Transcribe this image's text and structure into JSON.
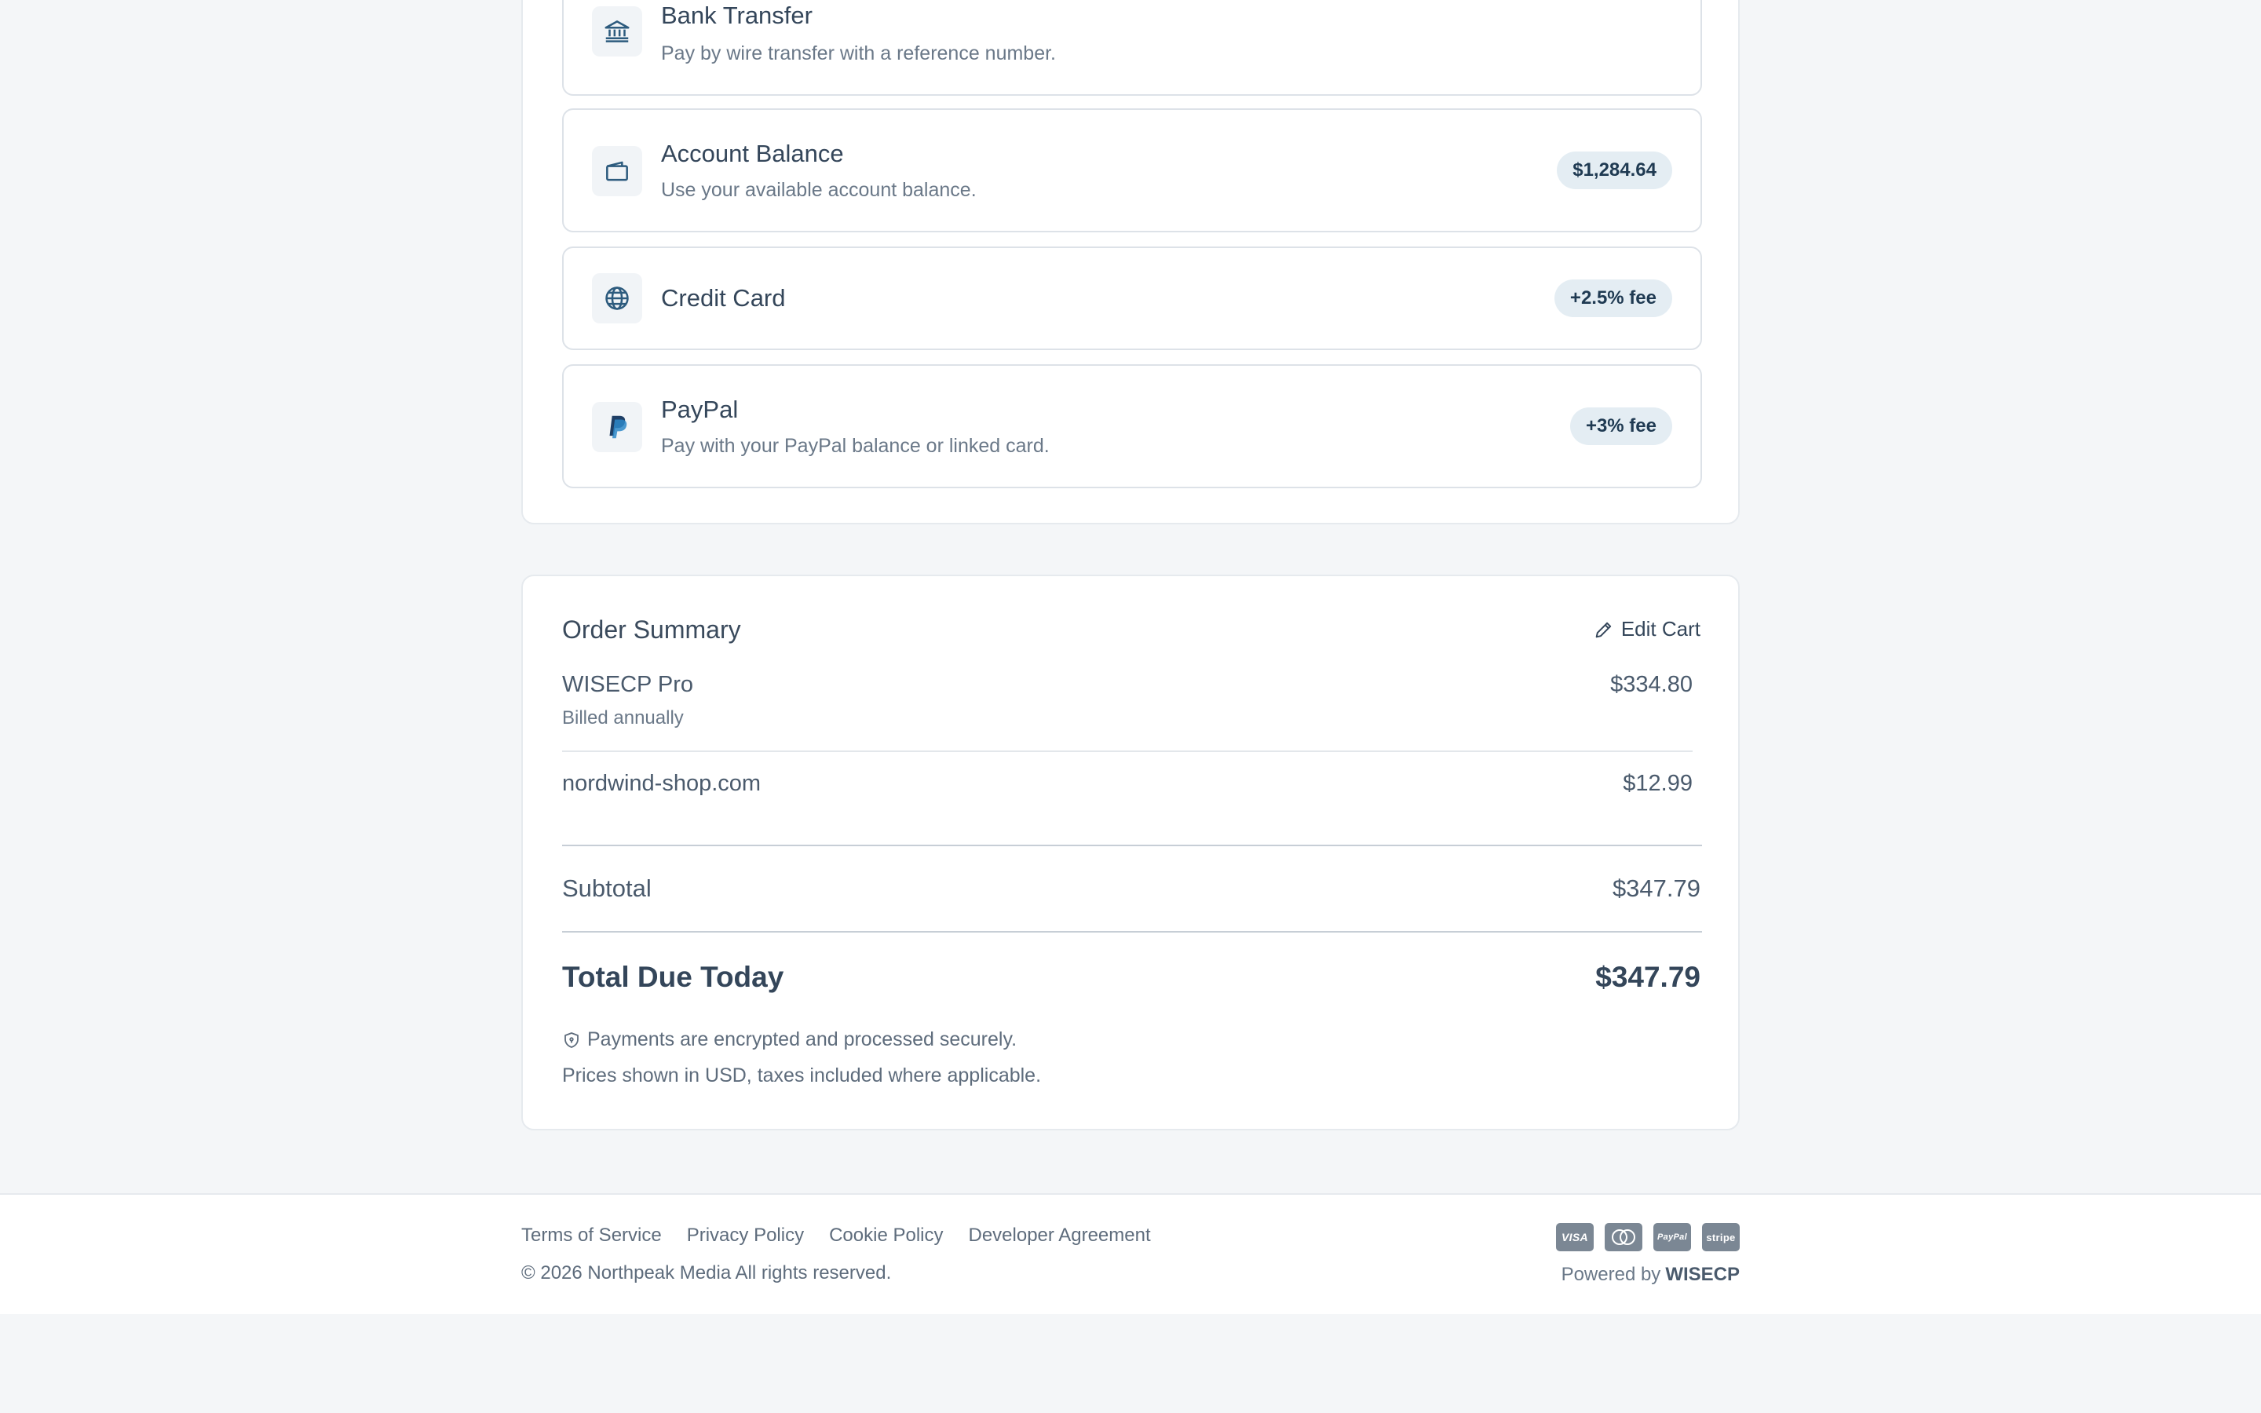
{
  "payment_methods": [
    {
      "id": "bank",
      "title": "Bank Transfer",
      "description": "Pay by wire transfer with a reference number.",
      "badge": "",
      "icon": "bank-icon"
    },
    {
      "id": "balance",
      "title": "Account Balance",
      "description": "Use your available account balance.",
      "badge": "$1,284.64",
      "icon": "wallet-icon"
    },
    {
      "id": "credit_card",
      "title": "Credit Card",
      "description": "",
      "badge": "+2.5% fee",
      "icon": "globe-icon"
    },
    {
      "id": "paypal",
      "title": "PayPal",
      "description": "Pay with your PayPal balance or linked card.",
      "badge": "+3% fee",
      "icon": "paypal-icon"
    }
  ],
  "order_summary": {
    "title": "Order Summary",
    "edit_cart_label": "Edit Cart",
    "items": [
      {
        "name": "WISECP Pro",
        "sub": "Billed annually",
        "price": "$334.80"
      },
      {
        "name": "nordwind-shop.com",
        "sub": "",
        "price": "$12.99"
      }
    ],
    "subtotal_label": "Subtotal",
    "subtotal_value": "$347.79",
    "total_label": "Total Due Today",
    "total_value": "$347.79",
    "secure_note": "Payments are encrypted and processed securely.",
    "prices_note": "Prices shown in USD, taxes included where applicable."
  },
  "footer": {
    "links": [
      "Terms of Service",
      "Privacy Policy",
      "Cookie Policy",
      "Developer Agreement"
    ],
    "copyright": "© 2026 Northpeak Media All rights reserved.",
    "card_logos": [
      "VISA",
      "mastercard",
      "PayPal",
      "stripe"
    ],
    "powered_by_label": "Powered by",
    "powered_by_brand": "WISECP"
  },
  "colors": {
    "page_bg": "#f4f6f8",
    "card_bg": "#ffffff",
    "badge_bg": "#e4edf3",
    "badge_text": "#1f3a52",
    "icon_color": "#2d5b7e"
  }
}
